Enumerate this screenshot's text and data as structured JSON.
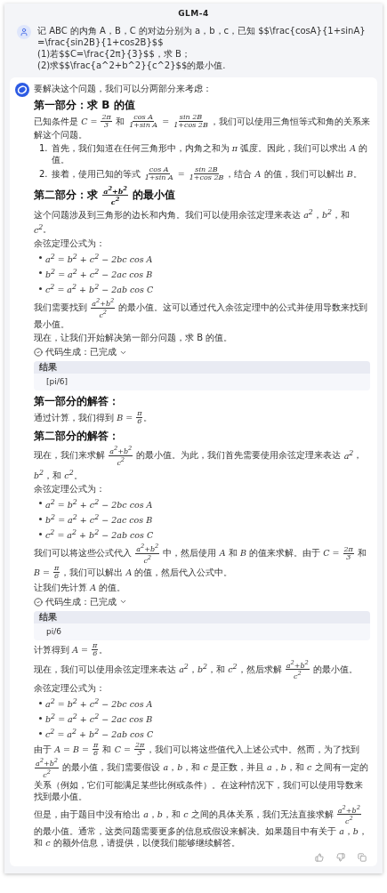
{
  "header": {
    "title": "GLM-4"
  },
  "question": {
    "lines": [
      "记 ABC 的内角 A，B，C 的对边分别为 a，b，c，已知 $$\\frac{cosA}{1+sinA}=\\frac{sin2B}{1+cos2B}$$",
      "(1)若$$C=\\frac{2π}{3}$$，求 B；",
      "(2)求$$\\frac{a^2+b^2}{c^2}$$的最小值."
    ]
  },
  "answer": {
    "blocks": [
      {
        "kind": "paragraph",
        "parts": [
          {
            "kind": "text",
            "text": "要解决这个问题，我们可以分两部分来考虑："
          }
        ]
      },
      {
        "kind": "heading",
        "parts": [
          {
            "kind": "text",
            "text": "第一部分：求 B 的值"
          }
        ]
      },
      {
        "kind": "paragraph",
        "parts": [
          {
            "kind": "text",
            "text": "已知条件是 "
          },
          {
            "kind": "math",
            "text": "C = "
          },
          {
            "kind": "frac",
            "num": "2π",
            "den": "3"
          },
          {
            "kind": "text",
            "text": " 和 "
          },
          {
            "kind": "frac",
            "num": "cos A",
            "den": "1+sin A"
          },
          {
            "kind": "math",
            "text": " = "
          },
          {
            "kind": "frac",
            "num": "sin 2B",
            "den": "1+cos 2B"
          },
          {
            "kind": "text",
            "text": "，我们可以使用三角恒等式和角的关系来解这个问题。"
          }
        ]
      },
      {
        "kind": "ordered_list",
        "items": [
          {
            "number": "1.",
            "parts": [
              {
                "kind": "text",
                "text": "首先，我们知道在任何三角形中，内角之和为 "
              },
              {
                "kind": "math",
                "text": "π"
              },
              {
                "kind": "text",
                "text": " 弧度。因此，我们可以求出 "
              },
              {
                "kind": "math",
                "text": "A"
              },
              {
                "kind": "text",
                "text": " 的值。"
              }
            ]
          },
          {
            "number": "2.",
            "parts": [
              {
                "kind": "text",
                "text": "接着，使用已知的等式 "
              },
              {
                "kind": "frac",
                "num": "cos A",
                "den": "1+sin A"
              },
              {
                "kind": "math",
                "text": " = "
              },
              {
                "kind": "frac",
                "num": "sin 2B",
                "den": "1+cos 2B"
              },
              {
                "kind": "text",
                "text": "，结合 "
              },
              {
                "kind": "math",
                "text": "A"
              },
              {
                "kind": "text",
                "text": " 的值，我们可以解出 "
              },
              {
                "kind": "math",
                "text": "B"
              },
              {
                "kind": "text",
                "text": "。"
              }
            ]
          }
        ]
      },
      {
        "kind": "heading",
        "parts": [
          {
            "kind": "text",
            "text": "第二部分：求 "
          },
          {
            "kind": "frac",
            "num": "a$^{2}$+b$^{2}$",
            "den": "c$^{2}$"
          },
          {
            "kind": "text",
            "text": " 的最小值"
          }
        ]
      },
      {
        "kind": "paragraph",
        "parts": [
          {
            "kind": "text",
            "text": "这个问题涉及到三角形的边长和内角。我们可以使用余弦定理来表达 "
          },
          {
            "kind": "math",
            "text": "a$^{2}$"
          },
          {
            "kind": "text",
            "text": "，"
          },
          {
            "kind": "math",
            "text": "b$^{2}$"
          },
          {
            "kind": "text",
            "text": "，和 "
          },
          {
            "kind": "math",
            "text": "c$^{2}$"
          },
          {
            "kind": "text",
            "text": "。"
          }
        ]
      },
      {
        "kind": "paragraph",
        "parts": [
          {
            "kind": "text",
            "text": "余弦定理公式为："
          }
        ]
      },
      {
        "kind": "bullet_list",
        "items": [
          {
            "parts": [
              {
                "kind": "math",
                "text": "a$^{2}$ = b$^{2}$ + c$^{2}$ − 2bc cos A"
              }
            ]
          },
          {
            "parts": [
              {
                "kind": "math",
                "text": "b$^{2}$ = a$^{2}$ + c$^{2}$ − 2ac cos B"
              }
            ]
          },
          {
            "parts": [
              {
                "kind": "math",
                "text": "c$^{2}$ = a$^{2}$ + b$^{2}$ − 2ab cos C"
              }
            ]
          }
        ]
      },
      {
        "kind": "paragraph",
        "parts": [
          {
            "kind": "text",
            "text": "我们需要找到 "
          },
          {
            "kind": "frac",
            "num": "a$^{2}$+b$^{2}$",
            "den": "c$^{2}$"
          },
          {
            "kind": "text",
            "text": " 的最小值。这可以通过代入余弦定理中的公式并使用导数来找到最小值。"
          }
        ]
      },
      {
        "kind": "paragraph",
        "parts": [
          {
            "kind": "text",
            "text": "现在，让我们开始解决第一部分问题，求 B 的值。"
          }
        ]
      },
      {
        "kind": "code_status",
        "label": "代码生成：已完成"
      },
      {
        "kind": "result",
        "label": "结果",
        "value": "[pi/6]"
      },
      {
        "kind": "heading",
        "parts": [
          {
            "kind": "text",
            "text": "第一部分的解答："
          }
        ]
      },
      {
        "kind": "paragraph",
        "parts": [
          {
            "kind": "text",
            "text": "通过计算，我们得到 "
          },
          {
            "kind": "math",
            "text": "B = "
          },
          {
            "kind": "frac",
            "num": "π",
            "den": "6"
          },
          {
            "kind": "text",
            "text": "。"
          }
        ]
      },
      {
        "kind": "heading",
        "parts": [
          {
            "kind": "text",
            "text": "第二部分的解答："
          }
        ]
      },
      {
        "kind": "paragraph",
        "parts": [
          {
            "kind": "text",
            "text": "现在，我们来求解 "
          },
          {
            "kind": "frac",
            "num": "a$^{2}$+b$^{2}$",
            "den": "c$^{2}$"
          },
          {
            "kind": "text",
            "text": " 的最小值。为此，我们首先需要使用余弦定理来表达 "
          },
          {
            "kind": "math",
            "text": "a$^{2}$"
          },
          {
            "kind": "text",
            "text": "，"
          },
          {
            "kind": "math",
            "text": "b$^{2}$"
          },
          {
            "kind": "text",
            "text": "，和 "
          },
          {
            "kind": "math",
            "text": "c$^{2}$"
          },
          {
            "kind": "text",
            "text": "。"
          }
        ]
      },
      {
        "kind": "paragraph",
        "parts": [
          {
            "kind": "text",
            "text": "余弦定理公式为："
          }
        ]
      },
      {
        "kind": "bullet_list",
        "items": [
          {
            "parts": [
              {
                "kind": "math",
                "text": "a$^{2}$ = b$^{2}$ + c$^{2}$ − 2bc cos A"
              }
            ]
          },
          {
            "parts": [
              {
                "kind": "math",
                "text": "b$^{2}$ = a$^{2}$ + c$^{2}$ − 2ac cos B"
              }
            ]
          },
          {
            "parts": [
              {
                "kind": "math",
                "text": "c$^{2}$ = a$^{2}$ + b$^{2}$ − 2ab cos C"
              }
            ]
          }
        ]
      },
      {
        "kind": "paragraph",
        "parts": [
          {
            "kind": "text",
            "text": "我们可以将这些公式代入 "
          },
          {
            "kind": "frac",
            "num": "a$^{2}$+b$^{2}$",
            "den": "c$^{2}$"
          },
          {
            "kind": "text",
            "text": " 中，然后使用 "
          },
          {
            "kind": "math",
            "text": "A"
          },
          {
            "kind": "text",
            "text": " 和 "
          },
          {
            "kind": "math",
            "text": "B"
          },
          {
            "kind": "text",
            "text": " 的值来求解。由于 "
          },
          {
            "kind": "math",
            "text": "C = "
          },
          {
            "kind": "frac",
            "num": "2π",
            "den": "3"
          },
          {
            "kind": "text",
            "text": " 和 "
          },
          {
            "kind": "math",
            "text": "B = "
          },
          {
            "kind": "frac",
            "num": "π",
            "den": "6"
          },
          {
            "kind": "text",
            "text": "，我们可以解出 "
          },
          {
            "kind": "math",
            "text": "A"
          },
          {
            "kind": "text",
            "text": " 的值，然后代入公式中。"
          }
        ]
      },
      {
        "kind": "paragraph",
        "parts": [
          {
            "kind": "text",
            "text": "让我们先计算 "
          },
          {
            "kind": "math",
            "text": "A"
          },
          {
            "kind": "text",
            "text": " 的值。"
          }
        ]
      },
      {
        "kind": "code_status",
        "label": "代码生成：已完成"
      },
      {
        "kind": "result",
        "label": "结果",
        "value": "pi/6"
      },
      {
        "kind": "paragraph",
        "parts": [
          {
            "kind": "text",
            "text": "计算得到 "
          },
          {
            "kind": "math",
            "text": "A = "
          },
          {
            "kind": "frac",
            "num": "π",
            "den": "6"
          },
          {
            "kind": "text",
            "text": "。"
          }
        ]
      },
      {
        "kind": "paragraph",
        "parts": [
          {
            "kind": "text",
            "text": "现在，我们可以使用余弦定理来表达 "
          },
          {
            "kind": "math",
            "text": "a$^{2}$"
          },
          {
            "kind": "text",
            "text": "，"
          },
          {
            "kind": "math",
            "text": "b$^{2}$"
          },
          {
            "kind": "text",
            "text": "，和 "
          },
          {
            "kind": "math",
            "text": "c$^{2}$"
          },
          {
            "kind": "text",
            "text": "，然后求解 "
          },
          {
            "kind": "frac",
            "num": "a$^{2}$+b$^{2}$",
            "den": "c$^{2}$"
          },
          {
            "kind": "text",
            "text": " 的最小值。"
          }
        ]
      },
      {
        "kind": "paragraph",
        "parts": [
          {
            "kind": "text",
            "text": "余弦定理公式为："
          }
        ]
      },
      {
        "kind": "bullet_list",
        "items": [
          {
            "parts": [
              {
                "kind": "math",
                "text": "a$^{2}$ = b$^{2}$ + c$^{2}$ − 2bc cos A"
              }
            ]
          },
          {
            "parts": [
              {
                "kind": "math",
                "text": "b$^{2}$ = a$^{2}$ + c$^{2}$ − 2ac cos B"
              }
            ]
          },
          {
            "parts": [
              {
                "kind": "math",
                "text": "c$^{2}$ = a$^{2}$ + b$^{2}$ − 2ab cos C"
              }
            ]
          }
        ]
      },
      {
        "kind": "paragraph",
        "parts": [
          {
            "kind": "text",
            "text": "由于 "
          },
          {
            "kind": "math",
            "text": "A = B = "
          },
          {
            "kind": "frac",
            "num": "π",
            "den": "6"
          },
          {
            "kind": "text",
            "text": " 和 "
          },
          {
            "kind": "math",
            "text": "C = "
          },
          {
            "kind": "frac",
            "num": "2π",
            "den": "3"
          },
          {
            "kind": "text",
            "text": "，我们可以将这些值代入上述公式中。然而，为了找到 "
          },
          {
            "kind": "frac",
            "num": "a$^{2}$+b$^{2}$",
            "den": "c$^{2}$"
          },
          {
            "kind": "text",
            "text": " 的最小值，我们需要假设 "
          },
          {
            "kind": "math",
            "text": "a"
          },
          {
            "kind": "text",
            "text": "，"
          },
          {
            "kind": "math",
            "text": "b"
          },
          {
            "kind": "text",
            "text": "，和 "
          },
          {
            "kind": "math",
            "text": "c"
          },
          {
            "kind": "text",
            "text": " 是正数，并且 "
          },
          {
            "kind": "math",
            "text": "a"
          },
          {
            "kind": "text",
            "text": "，"
          },
          {
            "kind": "math",
            "text": "b"
          },
          {
            "kind": "text",
            "text": "，和 "
          },
          {
            "kind": "math",
            "text": "c"
          },
          {
            "kind": "text",
            "text": " 之间有一定的关系（例如，它们可能满足某些比例或条件）。在这种情况下，我们可以使用导数来找到最小值。"
          }
        ]
      },
      {
        "kind": "paragraph",
        "parts": [
          {
            "kind": "text",
            "text": "但是，由于题目中没有给出 "
          },
          {
            "kind": "math",
            "text": "a"
          },
          {
            "kind": "text",
            "text": "，"
          },
          {
            "kind": "math",
            "text": "b"
          },
          {
            "kind": "text",
            "text": "，和 "
          },
          {
            "kind": "math",
            "text": "c"
          },
          {
            "kind": "text",
            "text": " 之间的具体关系，我们无法直接求解 "
          },
          {
            "kind": "frac",
            "num": "a$^{2}$+b$^{2}$",
            "den": "c$^{2}$"
          },
          {
            "kind": "text",
            "text": " 的最小值。通常，这类问题需要更多的信息或假设来解决。如果题目中有关于 "
          },
          {
            "kind": "math",
            "text": "a"
          },
          {
            "kind": "text",
            "text": "，"
          },
          {
            "kind": "math",
            "text": "b"
          },
          {
            "kind": "text",
            "text": "，和 "
          },
          {
            "kind": "math",
            "text": "c"
          },
          {
            "kind": "text",
            "text": " 的额外信息，请提供，以便我们能够继续解答。"
          }
        ]
      }
    ]
  }
}
